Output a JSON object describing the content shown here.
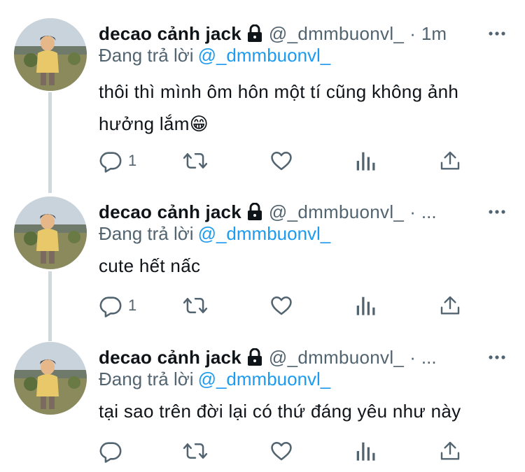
{
  "tweets": [
    {
      "name": "decao cảnh jack",
      "handle": "@_dmmbuonvl_",
      "dot": "·",
      "time": "1m",
      "replying_label": "Đang trả lời",
      "replying_to": "@_dmmbuonvl_",
      "text_line1": "thôi thì mình ôm hôn một tí cũng không ảnh",
      "text_line2": "hưởng lắm😁",
      "reply_count": "1"
    },
    {
      "name": "decao cảnh jack",
      "handle": "@_dmmbuonvl_",
      "dot": "·",
      "time": "...",
      "replying_label": "Đang trả lời",
      "replying_to": "@_dmmbuonvl_",
      "text_line1": "cute hết nấc",
      "reply_count": "1"
    },
    {
      "name": "decao cảnh jack",
      "handle": "@_dmmbuonvl_",
      "dot": "·",
      "time": "...",
      "replying_label": "Đang trả lời",
      "replying_to": "@_dmmbuonvl_",
      "text_line1": "tại sao trên đời lại có thứ đáng yêu như này",
      "reply_count": ""
    }
  ],
  "icons": {
    "reply": "reply-icon",
    "retweet": "retweet-icon",
    "like": "heart-icon",
    "views": "views-icon",
    "share": "share-icon",
    "lock": "lock-icon",
    "more": "more-icon"
  },
  "colors": {
    "text": "#0f1419",
    "muted": "#536471",
    "link": "#1d9bf0",
    "thread_line": "#cfd9de"
  }
}
